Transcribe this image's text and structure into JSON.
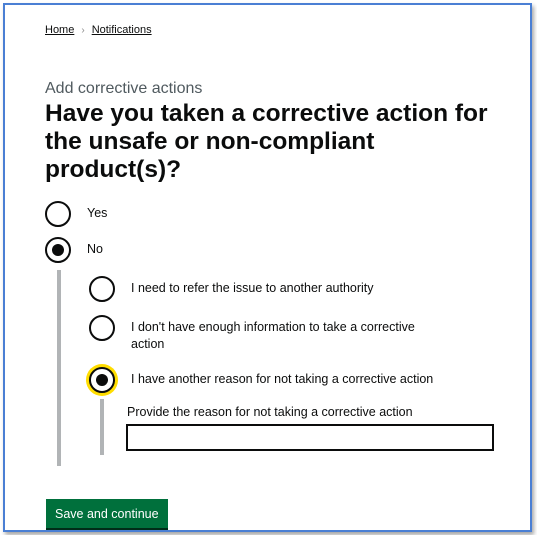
{
  "breadcrumb": {
    "home": "Home",
    "notifications": "Notifications",
    "separator": "›"
  },
  "caption": "Add corrective actions",
  "heading": "Have you taken a corrective action for the unsafe or non-compliant product(s)?",
  "options": {
    "yes": {
      "label": "Yes",
      "checked": false
    },
    "no": {
      "label": "No",
      "checked": true
    }
  },
  "sub_options": {
    "refer": {
      "label": "I need to refer the issue to another authority",
      "checked": false
    },
    "info": {
      "label": "I don't have enough information to take a corrective action",
      "checked": false
    },
    "other": {
      "label": "I have another reason for not taking a corrective action",
      "checked": true
    }
  },
  "reason_field": {
    "label": "Provide the reason for not taking a corrective action",
    "value": ""
  },
  "submit_label": "Save and continue",
  "colors": {
    "button": "#00703c",
    "focus": "#ffdd00",
    "frame": "#4a7fd4"
  }
}
